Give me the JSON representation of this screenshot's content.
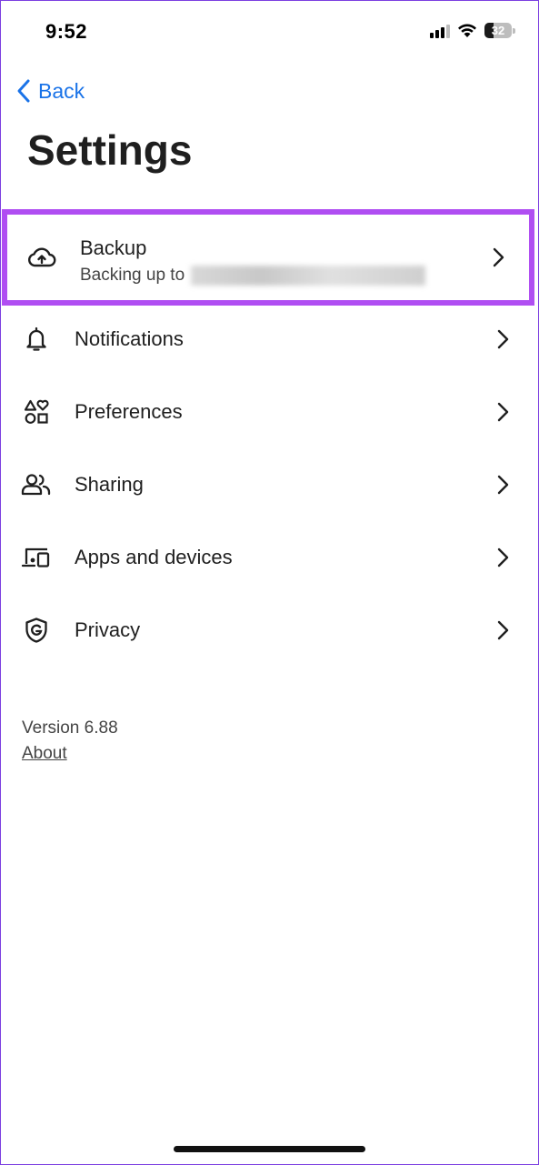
{
  "status_bar": {
    "time": "9:52",
    "battery": "32"
  },
  "nav": {
    "back_label": "Back"
  },
  "page": {
    "title": "Settings"
  },
  "settings": [
    {
      "id": "backup",
      "label": "Backup",
      "sublabel": "Backing up to",
      "icon": "cloud-upload-icon",
      "highlighted": true
    },
    {
      "id": "notifications",
      "label": "Notifications",
      "icon": "bell-icon"
    },
    {
      "id": "preferences",
      "label": "Preferences",
      "icon": "shapes-icon"
    },
    {
      "id": "sharing",
      "label": "Sharing",
      "icon": "people-icon"
    },
    {
      "id": "apps_devices",
      "label": "Apps and devices",
      "icon": "devices-icon"
    },
    {
      "id": "privacy",
      "label": "Privacy",
      "icon": "shield-g-icon"
    }
  ],
  "footer": {
    "version": "Version 6.88",
    "about": "About"
  },
  "colors": {
    "accent": "#1a73e8",
    "highlight": "#b04ef2",
    "text": "#1f1f1f"
  }
}
